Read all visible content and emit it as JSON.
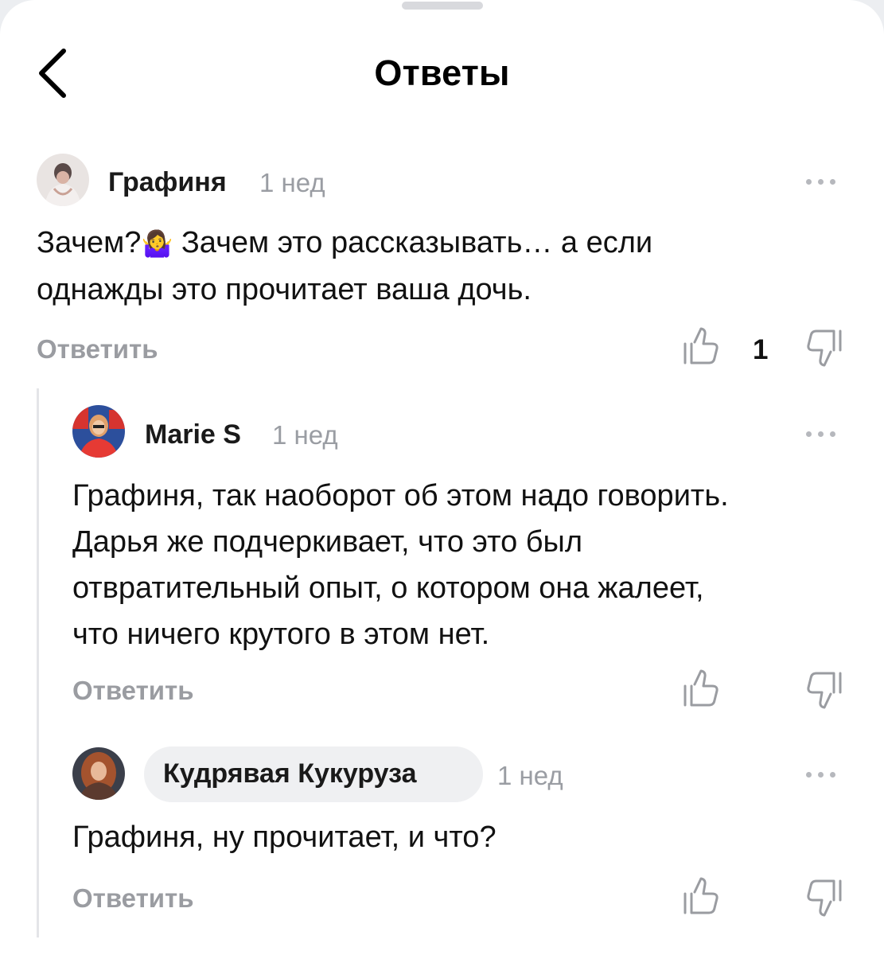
{
  "header": {
    "title": "Ответы",
    "back_icon": "chevron-left-icon"
  },
  "comments": [
    {
      "author": "Графиня",
      "time": "1 нед",
      "text_before_emoji": "Зачем?",
      "emoji": "🤷‍♀️",
      "text_line1_rest": " Зачем это рассказывать… а если",
      "text_line2": "однажды это прочитает ваша дочь.",
      "reply_label": "Ответить",
      "like_count": "1"
    },
    {
      "author": "Marie S",
      "time": "1 нед",
      "text_lines": [
        "Графиня, так наоборот об этом надо говорить.",
        "Дарья же подчеркивает, что это был",
        "отвратительный опыт, о котором она жалеет,",
        "что ничего крутого в этом нет."
      ],
      "reply_label": "Ответить"
    },
    {
      "author": "Кудрявая Кукуруза",
      "time": "1 нед",
      "text_lines": [
        "Графиня, ну прочитает, и что?"
      ],
      "reply_label": "Ответить"
    }
  ],
  "colors": {
    "background": "#ffffff",
    "muted": "#9a9ca1",
    "divider": "#e4e5e8",
    "chip": "#eff0f2"
  }
}
